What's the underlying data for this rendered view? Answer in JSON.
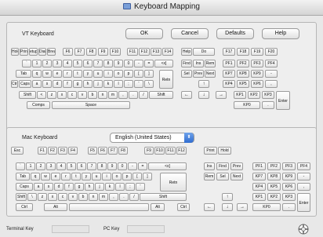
{
  "window": {
    "title": "Keyboard Mapping"
  },
  "vt": {
    "label": "VT Keyboard",
    "ok": "OK",
    "cancel": "Cancel",
    "defaults": "Defaults",
    "help": "Help",
    "keys": {
      "hold": "Hold",
      "print": "Print",
      "setup": "etup",
      "dial": "Dial",
      "break": "Break",
      "f6": "F6",
      "f7": "F7",
      "f8": "F8",
      "f9": "F9",
      "f10": "F10",
      "f11": "F11",
      "f12": "F12",
      "f13": "F13",
      "f14": "F14",
      "help": "Help",
      "do": "Do",
      "f17": "F17",
      "f18": "F18",
      "f19": "F19",
      "f20": "F20",
      "backtick": "`",
      "n1": "1",
      "n2": "2",
      "n3": "3",
      "n4": "4",
      "n5": "5",
      "n6": "6",
      "n7": "7",
      "n8": "8",
      "n9": "9",
      "n0": "0",
      "minus": "-",
      "equals": "=",
      "del": "<x]",
      "find": "Find",
      "ins": "Ins",
      "rem": "Rem",
      "pf1": "PF1",
      "pf2": "PF2",
      "pf3": "PF3",
      "pf4": "PF4",
      "tab": "Tab",
      "q": "q",
      "w": "w",
      "e": "e",
      "r": "r",
      "t": "t",
      "y": "y",
      "u": "u",
      "i": "i",
      "o": "o",
      "p": "p",
      "lbr": "[",
      "rbr": "]",
      "ret": "Retn",
      "sel": "Sel",
      "prev": "Prev",
      "next": "Next",
      "kp7": "KP7",
      "kp8": "KP8",
      "kp9": "KP9",
      "kpminus": "-",
      "ctrl": "Ctrl",
      "caps": "Caps",
      "a": "a",
      "s": "s",
      "d": "d",
      "f": "f",
      "g": "g",
      "h": "h",
      "j": "j",
      "k": "k",
      "l": "l",
      "semi": ";",
      "quote": "'",
      "bslash": "\\",
      "up": "↑",
      "kp4": "KP4",
      "kp5": "KP5",
      "kp6": "KP6",
      "kpcomma": ",",
      "shiftl": "Shift",
      "lt": "<",
      "z": "z",
      "x": "x",
      "c": "c",
      "v": "v",
      "b": "b",
      "n": "n",
      "m": "m",
      "comma": ",",
      "period": ".",
      "slash": "/",
      "shiftr": "Shift",
      "left": "←",
      "down": "↓",
      "right": "→",
      "kp1": "KP1",
      "kp2": "KP2",
      "kp3": "KP3",
      "enter": "Enter",
      "comps": "Comps",
      "space": "Space",
      "kp0": "KP0",
      "kpdot": "."
    }
  },
  "mac": {
    "label": "Mac Keyboard",
    "layout_selected": "English (United States)",
    "layout_arrow": "⬍",
    "keys": {
      "esc": "Esc",
      "f1": "F1",
      "f2": "F2",
      "f3": "F3",
      "f4": "F4",
      "f5": "F5",
      "f6": "F6",
      "f7": "F7",
      "f8": "F8",
      "f9": "F9",
      "f10": "F10",
      "f11": "F11",
      "f12": "F12",
      "print": "Print",
      "hold": "Hold",
      "backtick": "`",
      "n1": "1",
      "n2": "2",
      "n3": "3",
      "n4": "4",
      "n5": "5",
      "n6": "6",
      "n7": "7",
      "n8": "8",
      "n9": "9",
      "n0": "0",
      "minus": "-",
      "equals": "=",
      "del": "<x]",
      "ins": "Ins",
      "find": "Find",
      "prev": "Prev",
      "pf1": "PF1",
      "pf2": "PF2",
      "pf3": "PF3",
      "pf4": "PF4",
      "tab": "Tab",
      "q": "q",
      "w": "w",
      "e": "e",
      "r": "r",
      "t": "t",
      "y": "y",
      "u": "u",
      "i": "i",
      "o": "o",
      "p": "p",
      "lbr": "[",
      "rbr": "]",
      "ret": "Retn",
      "rem": "Rem",
      "sel": "Sel",
      "next": "Next",
      "kp7": "KP7",
      "kp8": "KP8",
      "kp9": "KP9",
      "kpminus": "-",
      "caps": "Caps",
      "a": "a",
      "s": "s",
      "d": "d",
      "f": "f",
      "g": "g",
      "h": "h",
      "j": "j",
      "k": "k",
      "l": "l",
      "semi": ";",
      "quote": "'",
      "kp4": "KP4",
      "kp5": "KP5",
      "kp6": "KP6",
      "kpcomma": ",",
      "shiftl": "Shift",
      "bslash": "\\",
      "z": "z",
      "x": "x",
      "c": "c",
      "v": "v",
      "b": "b",
      "n": "n",
      "m": "m",
      "comma": ",",
      "period": ".",
      "slash": "/",
      "shiftr": "Shift",
      "up": "↑",
      "kp1": "KP1",
      "kp2": "KP2",
      "kp3": "KP3",
      "enter": "Enter",
      "ctrl": "Ctrl",
      "alt": "Alt",
      "altr": "Alt",
      "ctrlr": "Ctrl",
      "left": "←",
      "down": "↓",
      "right": "→",
      "kp0": "KP0",
      "kpdot": "."
    }
  },
  "status": {
    "terminal_key_label": "Terminal Key",
    "pc_key_label": "PC Key"
  },
  "icons": {
    "help": "lifebuoy-help-icon"
  }
}
